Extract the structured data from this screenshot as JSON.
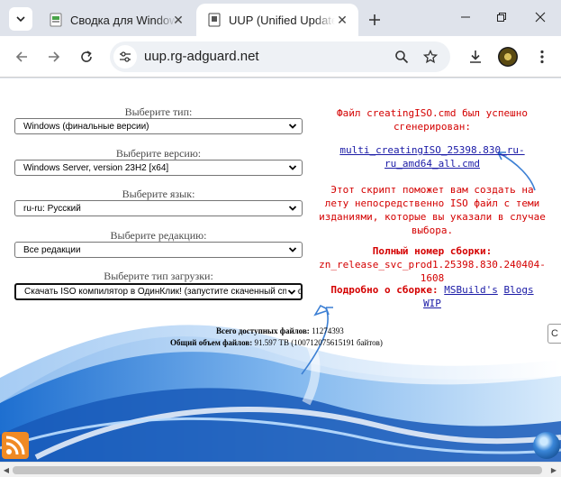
{
  "tabs": [
    {
      "title": "Сводка для Window",
      "active": false
    },
    {
      "title": "UUP (Unified Update",
      "active": true
    }
  ],
  "address_bar": {
    "url": "uup.rg-adguard.net"
  },
  "form": {
    "fields": [
      {
        "label": "Выберите тип:",
        "value": "Windows (финальные версии)",
        "focused": false
      },
      {
        "label": "Выберите версию:",
        "value": "Windows Server, version 23H2 [x64]",
        "focused": false
      },
      {
        "label": "Выберите язык:",
        "value": "ru-ru: Русский",
        "focused": false
      },
      {
        "label": "Выберите редакцию:",
        "value": "Все редакции",
        "focused": false
      },
      {
        "label": "Выберите тип загрузки:",
        "value": "Скачать ISO компилятор в ОдинКлик! (запустите скаченный cmd-файл)",
        "focused": true
      }
    ]
  },
  "stats": {
    "total_files_label": "Всего доступных файлов:",
    "total_files_value": "11274393",
    "total_size_label": "Общий объем файлов:",
    "total_size_value": "91.597 TB (100712075615191 байтов)"
  },
  "result": {
    "success_line1": "Файл creatingISO.cmd был успешно",
    "success_line2": "сгенерирован:",
    "file_link_line1": "multi_creatingISO_25398.830_ru-",
    "file_link_line2": "ru_amd64_all.cmd",
    "desc_line1": "Этот скрипт поможет вам создать на",
    "desc_line2": "лету непосредственно ISO файл с теми",
    "desc_line3": "изданиями, которые вы указали в случае",
    "desc_line4": "выбора.",
    "build_label": "Полный номер сборки:",
    "build_line1": "zn_release_svc_prod1.25398.830.240404-",
    "build_line2": "1608",
    "more_label": "Подробно о сборке:",
    "msbuild_link": "MSBuild's",
    "blogs_link": "Blogs",
    "wip_link": "WIP"
  },
  "side_hint": "C",
  "colors": {
    "accent_red": "#d40000",
    "link_blue": "#1a1aa6",
    "arrow_blue": "#3b7fd4"
  }
}
